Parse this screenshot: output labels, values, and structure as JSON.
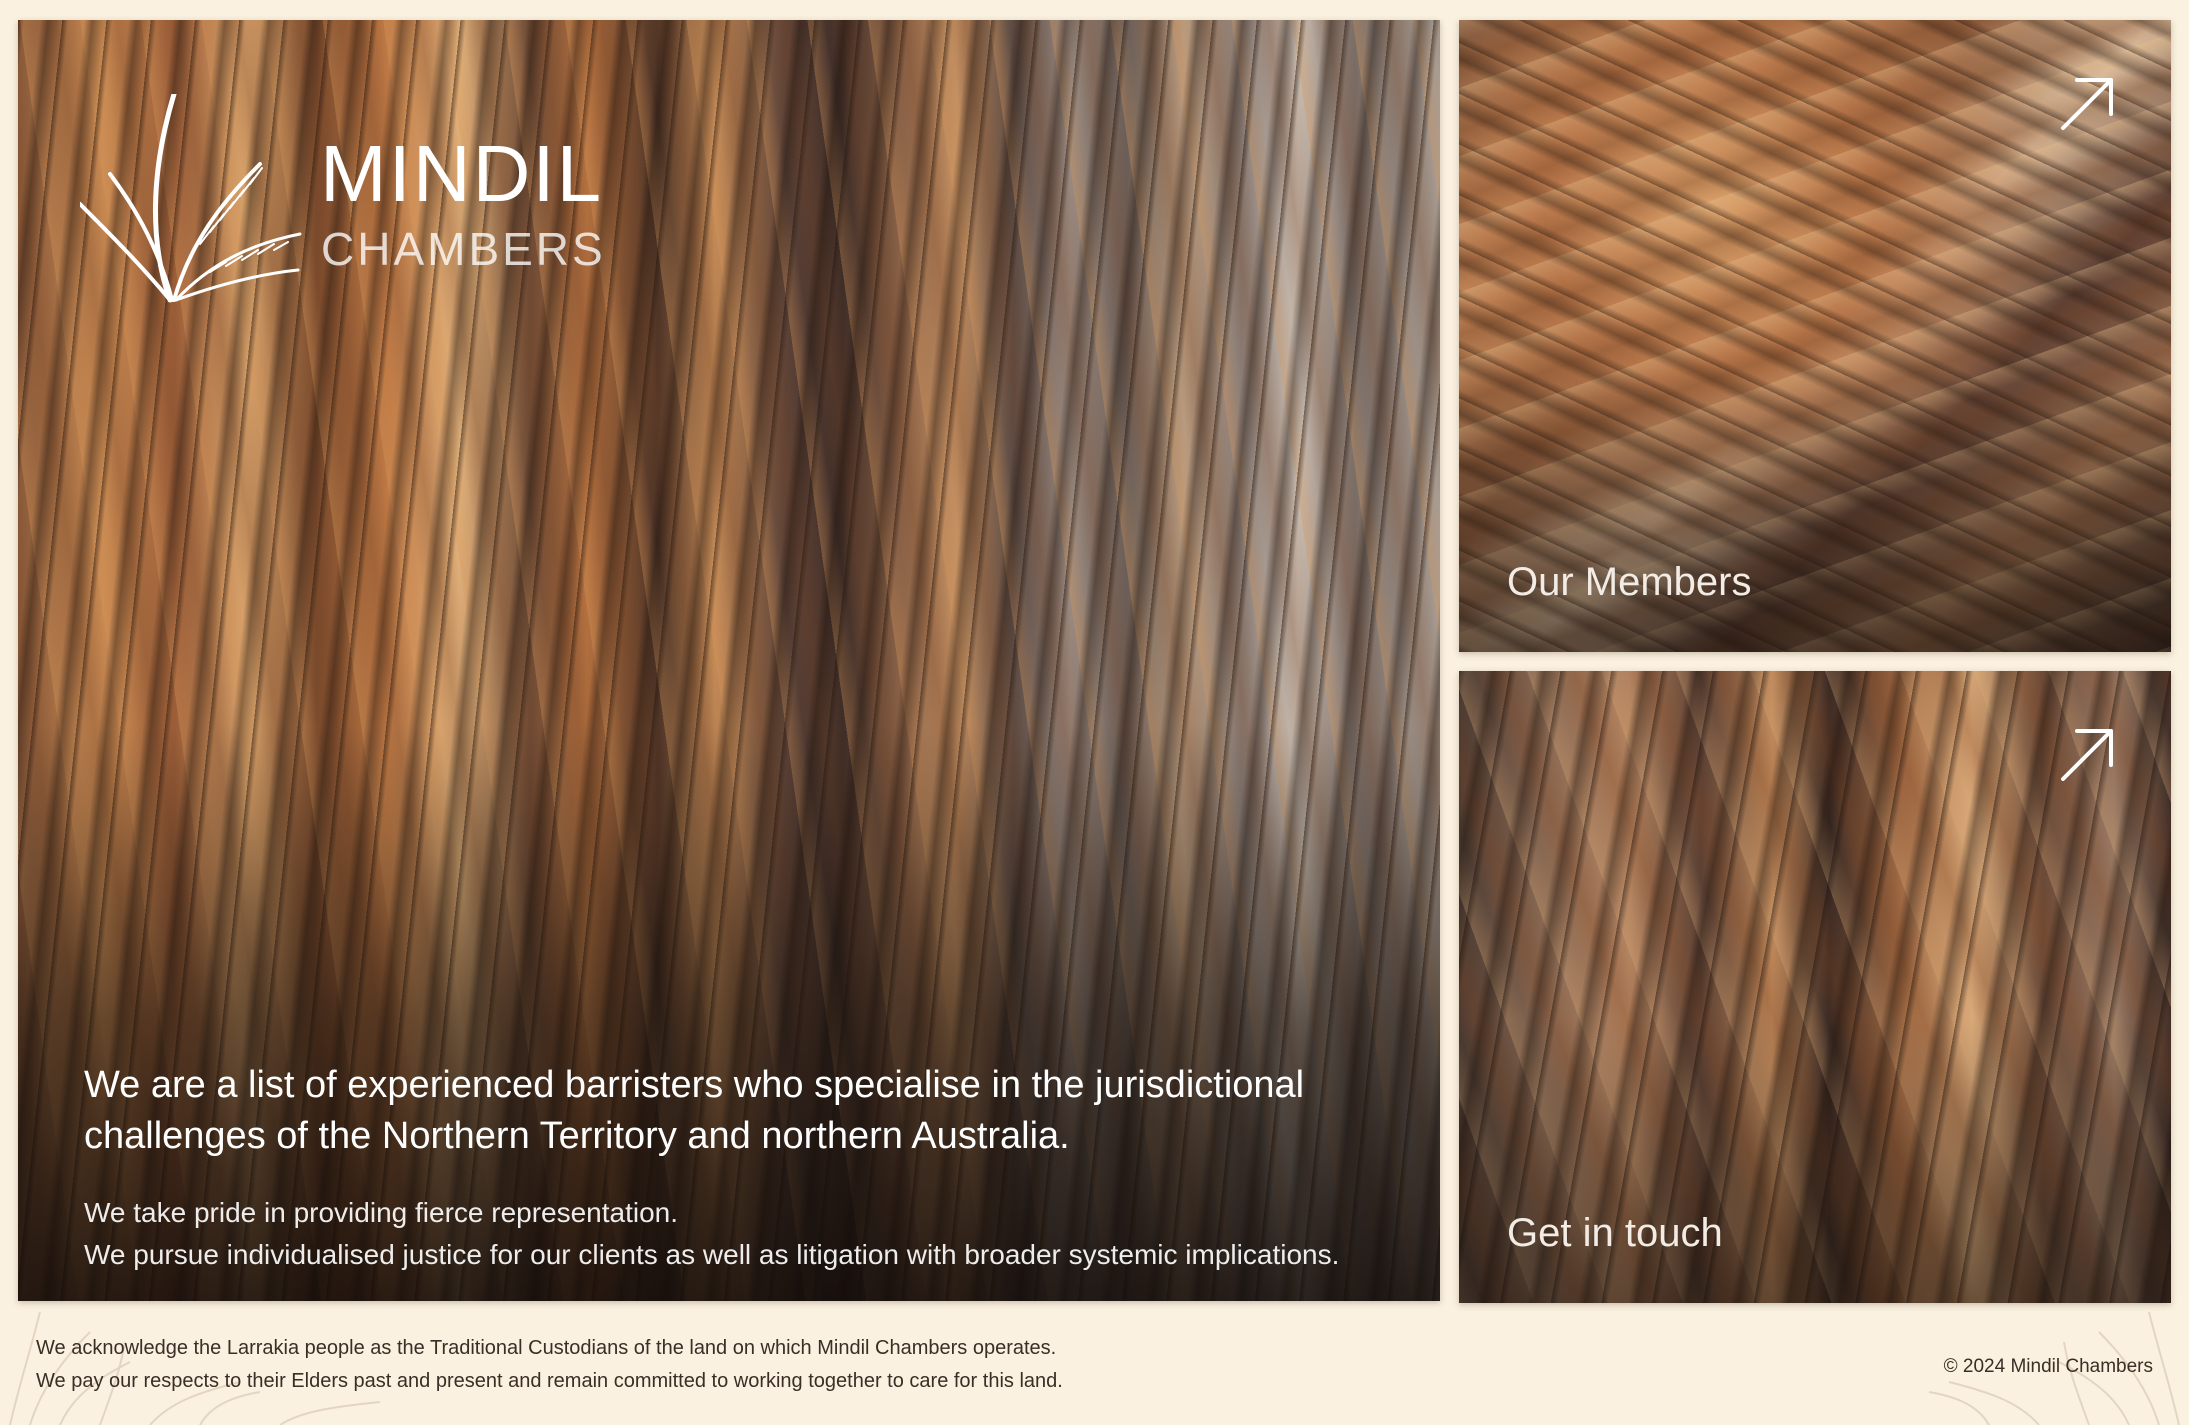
{
  "brand": {
    "name": "MINDIL",
    "sub": "CHAMBERS"
  },
  "intro": {
    "headline_line1": "We are a list of experienced barristers who specialise in the jurisdictional",
    "headline_line2": "challenges of the Northern Territory and northern Australia.",
    "line1": "We take pride in providing fierce representation.",
    "line2": "We pursue individualised justice for our clients as well as litigation with broader systemic implications."
  },
  "cards": {
    "members": {
      "label": "Our Members",
      "icon": "arrow-up-right-icon"
    },
    "contact": {
      "label": "Get in touch",
      "icon": "arrow-up-right-icon"
    }
  },
  "footer": {
    "ack_line1": "We acknowledge the Larrakia people as the Traditional Custodians of the land on which Mindil Chambers operates.",
    "ack_line2": "We pay our respects to their Elders past and present and remain committed to working together to care for this land.",
    "copyright": "© 2024 Mindil Chambers"
  },
  "colors": {
    "background": "#fbf1e0",
    "text_light": "#ffffff",
    "text_dark": "#3a2e26"
  }
}
